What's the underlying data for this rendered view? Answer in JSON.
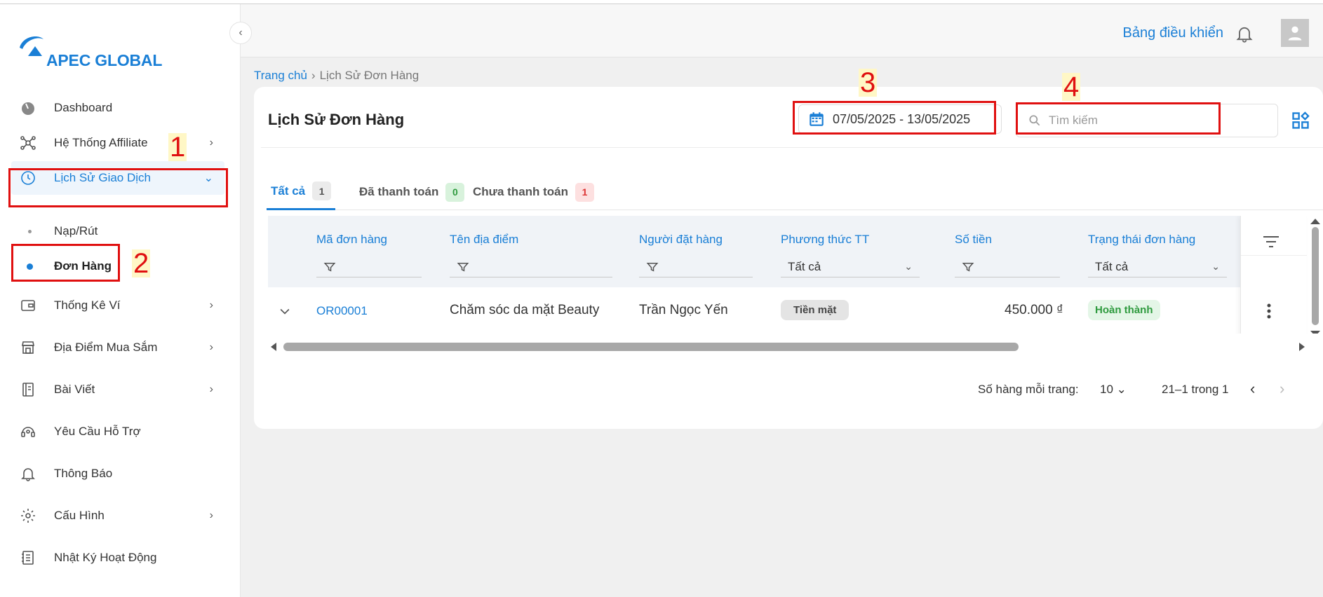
{
  "brand": {
    "name": "APEC GLOBAL",
    "color": "#1a7fd6"
  },
  "sidebar": {
    "items": [
      {
        "label": "Dashboard",
        "icon": "gauge-icon"
      },
      {
        "label": "Hệ Thống Affiliate",
        "icon": "network-icon",
        "has_children": true
      },
      {
        "label": "Lịch Sử Giao Dịch",
        "icon": "clock-icon",
        "has_children": true,
        "expanded": true,
        "active": true
      },
      {
        "label": "Nạp/Rút",
        "sub": true
      },
      {
        "label": "Đơn Hàng",
        "sub": true,
        "active": true
      },
      {
        "label": "Thống Kê Ví",
        "icon": "wallet-icon",
        "has_children": true
      },
      {
        "label": "Địa Điểm Mua Sắm",
        "icon": "store-icon",
        "has_children": true
      },
      {
        "label": "Bài Viết",
        "icon": "notebook-icon",
        "has_children": true
      },
      {
        "label": "Yêu Cầu Hỗ Trợ",
        "icon": "support-icon"
      },
      {
        "label": "Thông Báo",
        "icon": "bell-icon"
      },
      {
        "label": "Cấu Hình",
        "icon": "gear-icon",
        "has_children": true
      },
      {
        "label": "Nhật Ký Hoạt Động",
        "icon": "log-icon"
      }
    ]
  },
  "header": {
    "dashboard_link": "Bảng điều khiển"
  },
  "breadcrumb": {
    "home": "Trang chủ",
    "current": "Lịch Sử Đơn Hàng"
  },
  "page": {
    "title": "Lịch Sử Đơn Hàng",
    "date_range": "07/05/2025 - 13/05/2025",
    "search_placeholder": "Tìm kiếm"
  },
  "tabs": [
    {
      "label": "Tất cả",
      "count": "1",
      "active": true
    },
    {
      "label": "Đã thanh toán",
      "count": "0"
    },
    {
      "label": "Chưa thanh toán",
      "count": "1"
    }
  ],
  "table": {
    "columns": [
      "Mã đơn hàng",
      "Tên địa điểm",
      "Người đặt hàng",
      "Phương thức TT",
      "Số tiền",
      "Trạng thái đơn hàng"
    ],
    "filters": {
      "payment_method": "Tất cả",
      "status": "Tất cả"
    },
    "rows": [
      {
        "code": "OR00001",
        "place": "Chăm sóc da mặt Beauty",
        "customer": "Trần Ngọc Yến",
        "method": "Tiền mặt",
        "amount": "450.000 ₫",
        "status": "Hoàn thành"
      }
    ]
  },
  "pagination": {
    "rows_label": "Số hàng mỗi trang:",
    "rows_value": "10",
    "range": "21–1 trong 1"
  },
  "annotations": [
    "1",
    "2",
    "3",
    "4"
  ],
  "colors": {
    "accent": "#1a7fd6",
    "annotation_red": "#e01010",
    "success": "#2e9a3e"
  }
}
